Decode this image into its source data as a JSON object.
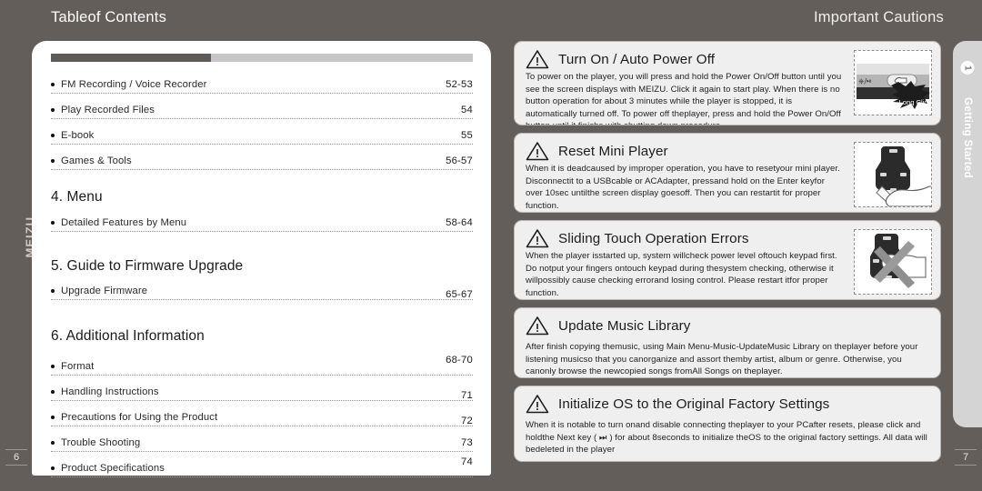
{
  "headers": {
    "left": "Tableof Contents",
    "right": "Important Cautions"
  },
  "brand": "MEIZU",
  "folio": {
    "left": "6",
    "right": "7"
  },
  "side_tab": {
    "badge": "1",
    "label": "Getting Started"
  },
  "progress_bar": {
    "filled_percent": 38
  },
  "toc": {
    "entries_top": [
      {
        "label": "FM Recording / Voice Recorder",
        "page": "52-53"
      },
      {
        "label": "Play Recorded Files",
        "page": "54"
      },
      {
        "label": "E-book",
        "page": "55"
      },
      {
        "label": "Games & Tools",
        "page": "56-57"
      }
    ],
    "section_menu": {
      "heading": "4. Menu",
      "entries": [
        {
          "label": "Detailed Features by Menu",
          "page": "58-64"
        }
      ]
    },
    "section_firmware": {
      "heading": "5. Guide to Firmware Upgrade",
      "entries": [
        {
          "label": "Upgrade Firmware",
          "page": "65-67"
        }
      ]
    },
    "section_additional": {
      "heading": "6. Additional Information",
      "entries": [
        {
          "label": "Format",
          "page": "68-70"
        },
        {
          "label": "Handling Instructions",
          "page": "71"
        },
        {
          "label": "Precautions for Using the Product",
          "page": "72"
        },
        {
          "label": "Trouble Shooting",
          "page": "73"
        },
        {
          "label": "Product Specifications",
          "page": "74"
        }
      ]
    }
  },
  "cautions": [
    {
      "title": "Turn On / Auto Power Off",
      "body": "To power on  the player, you will  press and hold the Power On/Off button until you see the screen displays with MEIZU. Click it again to start play. When there is no button operation for about 3 minutes while the player is stopped, it is automatically turned off. To power off theplayer, press and hold the Power On/Off button until it finishs with shutting down procedure.",
      "figure": "device-power-button",
      "figure_label": "Long Click"
    },
    {
      "title": "Reset Mini Player",
      "body": "When it is deadcaused by improper operation, you have to resetyour mini player. Disconnectit to a USBcable or ACAdapter, pressand hold on the Enter keyfor over 10sec untilthe screen display goesoff. Then you can restartit for proper function.",
      "figure": "device-hand-reset"
    },
    {
      "title": "Sliding Touch Operation Errors",
      "body": "When the player isstarted up, system willcheck power level oftouch keypad first. Do notput your fingers ontouch keypad during thesystem checking, otherwise it willpossibly cause checking errorand losing control. Please restart itfor proper function.",
      "figure": "device-touch-forbidden"
    },
    {
      "title": "Update Music Library",
      "body": "After finish copying themusic, using Main Menu-Music-UpdateMusic Library on theplayer before your listening musicso that you canorganize and assort themby artist, album or genre. Otherwise, you canonly browse the newcopied songs fromAll Songs on theplayer."
    },
    {
      "title": "Initialize OS to the Original Factory Settings",
      "body": "When it is notable to turn onand disable connecting theplayer to your PCafter resets, please click and holdthe Next key ( ⏭ ) for about 8seconds to initialize theOS to the original factory settings. All data will bedeleted in the player"
    }
  ],
  "colors": {
    "page_background": "#635e59",
    "paper": "#ffffff",
    "caution_fill": "#f0efef",
    "tab_fill": "#d4d4d4"
  }
}
